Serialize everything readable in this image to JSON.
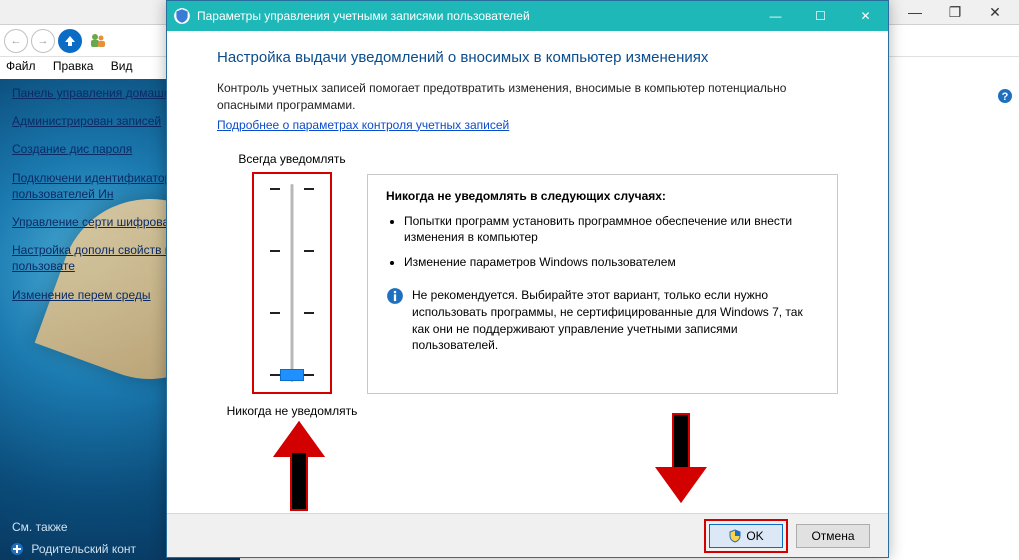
{
  "bg": {
    "win_buttons": {
      "min": "—",
      "max": "❐",
      "close": "✕"
    },
    "menu": {
      "file": "Файл",
      "edit": "Правка",
      "view": "Вид"
    },
    "sidebar": {
      "items": [
        "Панель управления домашняя страниц",
        "Администрирован записей",
        "Создание дис пароля",
        "Подключени идентификаторо пользователей Ин",
        "Управление серти шифрования файл",
        "Настройка дополн свойств профил пользовате",
        "Изменение перем среды"
      ],
      "see_also": "См. также",
      "parental": "Родительский конт"
    }
  },
  "dialog": {
    "title": "Параметры управления учетными записями пользователей",
    "heading": "Настройка выдачи уведомлений о вносимых в компьютер изменениях",
    "intro": "Контроль учетных записей помогает предотвратить изменения, вносимые в компьютер потенциально опасными программами.",
    "learn_more": "Подробнее о параметрах контроля учетных записей",
    "slider": {
      "top": "Всегда уведомлять",
      "bottom": "Никогда не уведомлять"
    },
    "desc": {
      "head": "Никогда не уведомлять в следующих случаях:",
      "bullet1": "Попытки программ установить программное обеспечение или внести изменения в компьютер",
      "bullet2": "Изменение параметров Windows пользователем",
      "warn": "Не рекомендуется. Выбирайте этот вариант, только если нужно использовать программы, не сертифицированные для Windows 7, так как они не поддерживают управление учетными записями пользователей."
    },
    "buttons": {
      "ok": "OK",
      "cancel": "Отмена"
    }
  }
}
